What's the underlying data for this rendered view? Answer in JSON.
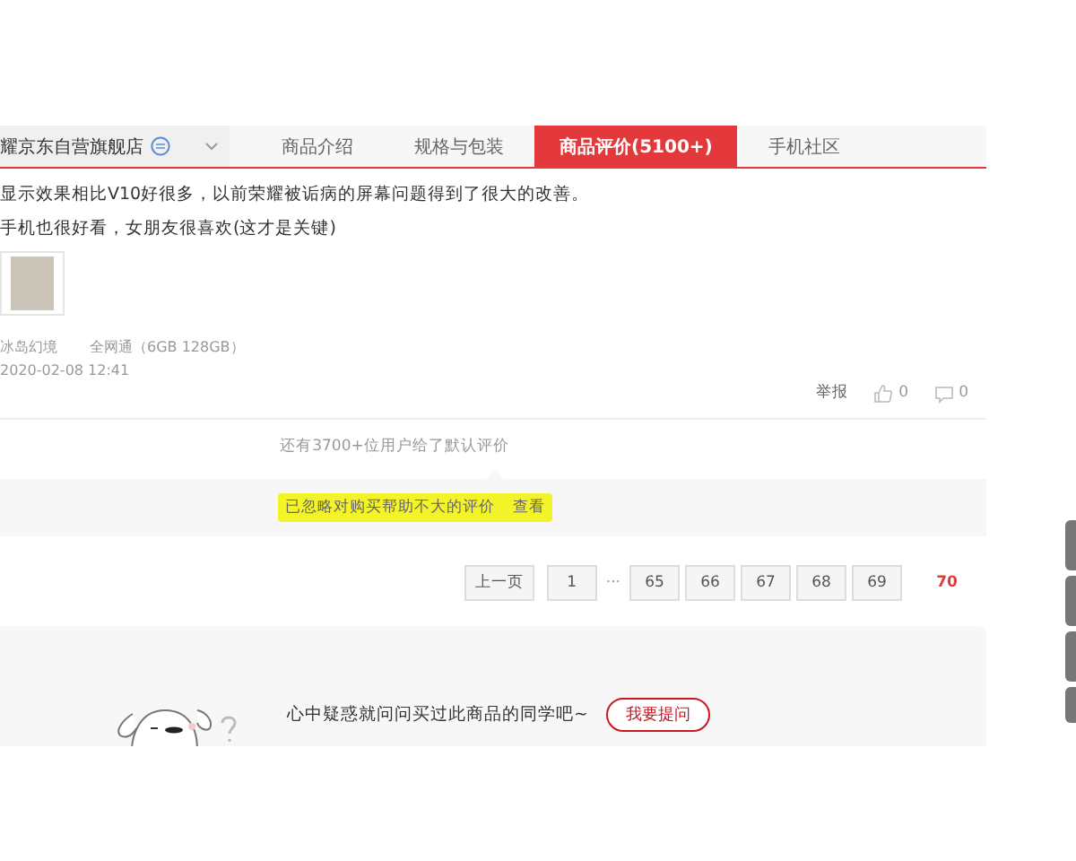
{
  "header": {
    "store_name": "耀京东自营旗舰店",
    "tabs": [
      {
        "label": "商品介绍",
        "selected": false
      },
      {
        "label": "规格与包装",
        "selected": false
      },
      {
        "label": "商品评价(5100+)",
        "selected": true
      },
      {
        "label": "手机社区",
        "selected": false
      }
    ]
  },
  "review": {
    "lines": [
      "显示效果相比V10好很多，以前荣耀被诟病的屏幕问题得到了很大的改善。",
      "手机也很好看，女朋友很喜欢(这才是关键)"
    ],
    "variant": "冰岛幻境",
    "spec": "全网通（6GB 128GB）",
    "date": "2020-02-08 12:41",
    "report": "举报",
    "likes": "0",
    "comments": "0"
  },
  "default_note": "还有3700+位用户给了默认评价",
  "folded": {
    "text": "已忽略对购买帮助不大的评价",
    "link": "查看",
    "highlighted": true
  },
  "pager": {
    "prev": "上一页",
    "ellipsis": "···",
    "pages": [
      {
        "label": "1",
        "selected": false
      },
      {
        "label": "65",
        "selected": false
      },
      {
        "label": "66",
        "selected": false
      },
      {
        "label": "67",
        "selected": false
      },
      {
        "label": "68",
        "selected": false
      },
      {
        "label": "69",
        "selected": false
      },
      {
        "label": "70",
        "selected": true
      }
    ]
  },
  "ask": {
    "text": "心中疑惑就问问买过此商品的同学吧~",
    "button": "我要提问"
  }
}
